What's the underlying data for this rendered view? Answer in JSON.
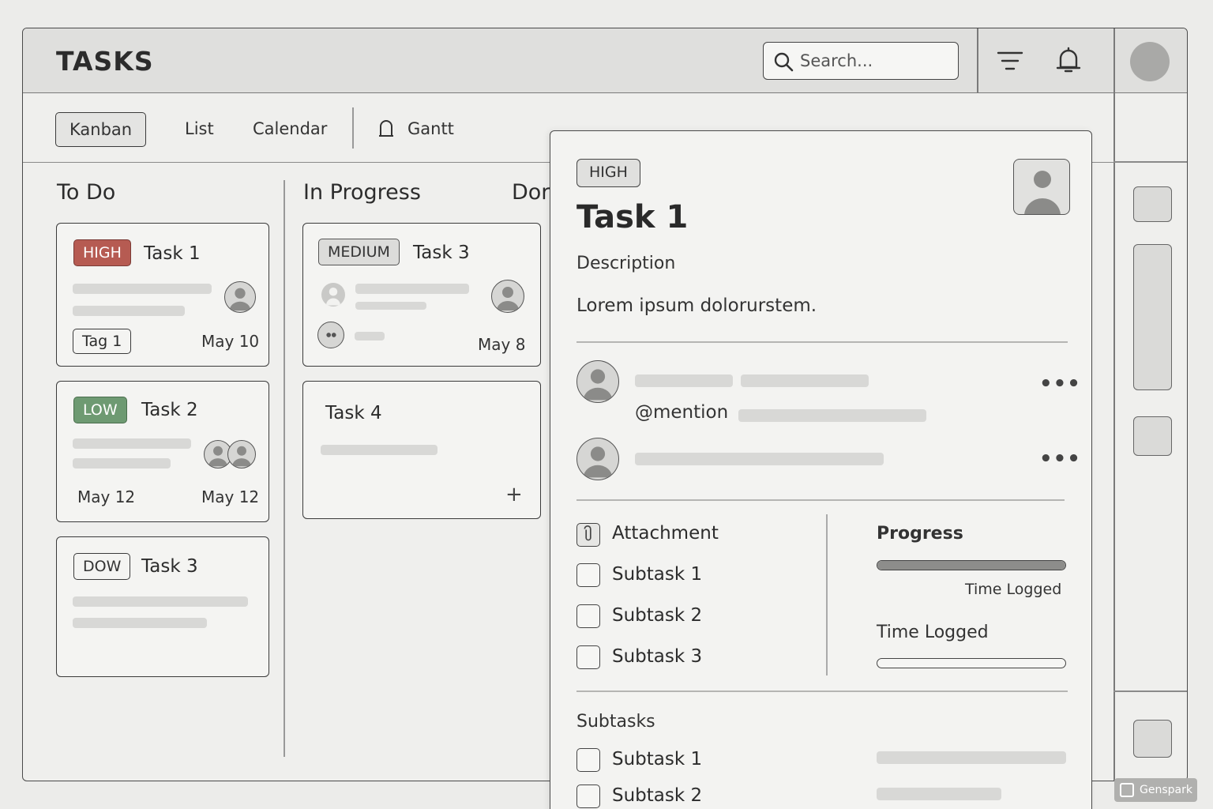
{
  "header": {
    "title": "TASKS",
    "search_placeholder": "Search..."
  },
  "views": {
    "tabs": [
      "Kanban",
      "List",
      "Calendar",
      "Gantt"
    ],
    "active": "Kanban"
  },
  "board": {
    "columns": [
      {
        "title": "To Do",
        "cards": [
          {
            "priority": "HIGH",
            "title": "Task 1",
            "tag": "Tag 1",
            "date": "May 10"
          },
          {
            "priority": "LOW",
            "title": "Task 2",
            "start_date": "May 12",
            "due_date": "May 12"
          },
          {
            "priority": "DOW",
            "title": "Task 3"
          }
        ]
      },
      {
        "title": "In Progress",
        "cards": [
          {
            "priority": "MEDIUM",
            "title": "Task 3",
            "date": "May 8"
          },
          {
            "title": "Task 4",
            "add_symbol": "+"
          }
        ]
      },
      {
        "title": "Dor"
      }
    ]
  },
  "detail": {
    "priority": "HIGH",
    "title": "Task 1",
    "description_label": "Description",
    "description": "Lorem ipsum dolorurstem.",
    "comments": {
      "mention": "@mention",
      "menu_symbol": "•••"
    },
    "attachment_label": "Attachment",
    "checklist": [
      "Subtask 1",
      "Subtask 2",
      "Subtask 3"
    ],
    "progress": {
      "label": "Progress",
      "value": 1.0,
      "time_logged_caption": "Time Logged",
      "time_logged_label": "Time Logged",
      "time_logged_value": 0
    },
    "subtasks_heading": "Subtasks",
    "subtasks": [
      "Subtask 1",
      "Subtask 2"
    ]
  },
  "watermark": "Genspark",
  "colors": {
    "high": "#b65b52",
    "low": "#6e9a72",
    "medium": "#dcdcda",
    "background": "#ececea"
  }
}
